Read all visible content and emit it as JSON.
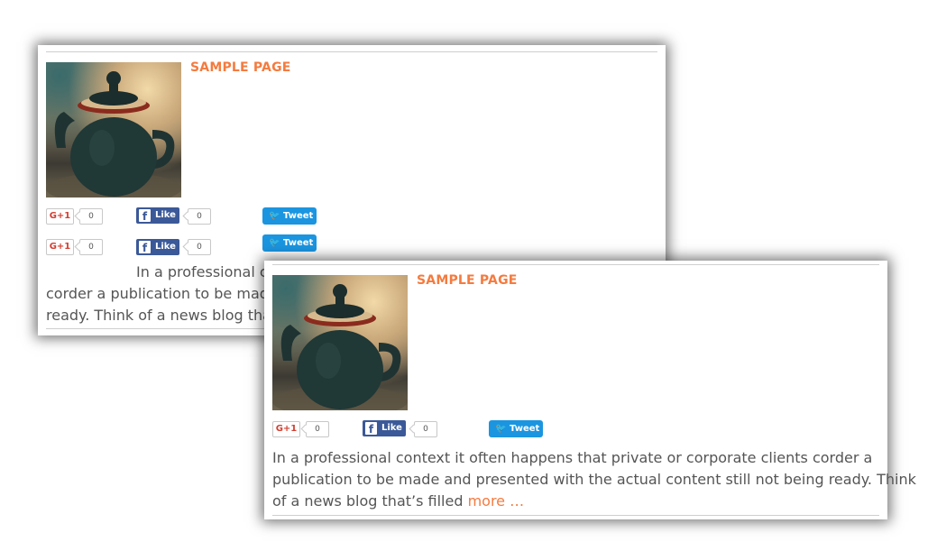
{
  "posts": [
    {
      "title": "SAMPLE PAGE",
      "share_rows": [
        {
          "gplus_label": "G+1",
          "gplus_count": "0",
          "fb_label": "Like",
          "fb_count": "0",
          "tweet_label": "Tweet"
        },
        {
          "gplus_label": "G+1",
          "gplus_count": "0",
          "fb_label": "Like",
          "fb_count": "0",
          "tweet_label": "Tweet"
        }
      ],
      "excerpt_lines": [
        "In a professional co",
        "corder a publication to be made",
        "ready. Think of a news blog that’s"
      ]
    },
    {
      "title": "SAMPLE PAGE",
      "share_rows": [
        {
          "gplus_label": "G+1",
          "gplus_count": "0",
          "fb_label": "Like",
          "fb_count": "0",
          "tweet_label": "Tweet"
        }
      ],
      "excerpt_lines": [
        "In a professional context it often happens that private or corporate clients corder a",
        "publication to be made and presented with the actual content still not being ready. Think",
        "of a news blog that’s filled "
      ],
      "more_label": "more …"
    }
  ],
  "icons": {
    "facebook": "f",
    "twitter": "bird"
  },
  "colors": {
    "accent": "#f47b3f",
    "facebook": "#3b5998",
    "twitter": "#1b95e0",
    "gplus": "#d23f31"
  }
}
